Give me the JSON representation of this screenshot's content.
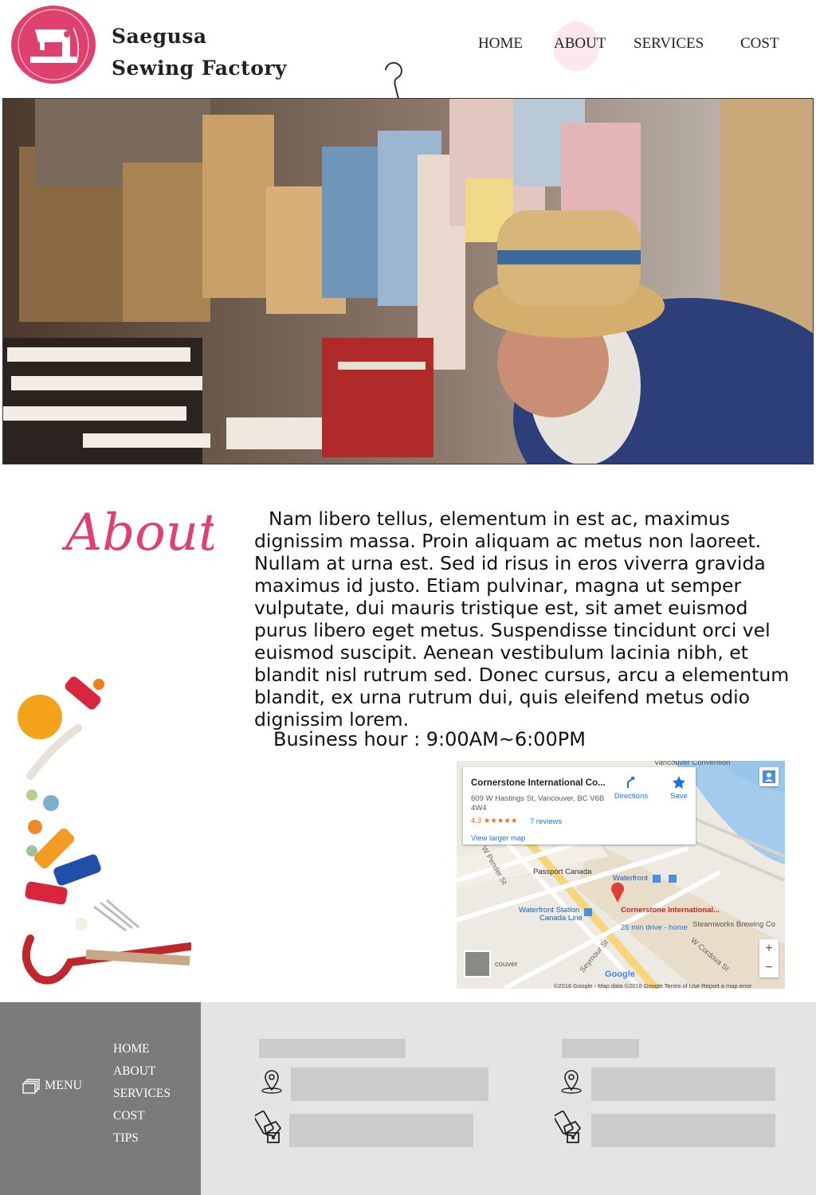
{
  "brand": {
    "line1": "Saegusa",
    "line2": "Sewing Factory",
    "accent_color": "#e0406e"
  },
  "nav": {
    "home": "HOME",
    "about": "ABOUT",
    "services": "SERVICES",
    "cost": "COST",
    "active": "ABOUT"
  },
  "about": {
    "heading": "About",
    "paragraph": "Nam libero tellus, elementum in est ac, maximus dignissim massa. Proin aliquam ac metus non laoreet. Nullam at urna est. Sed id risus in eros viverra gravida maximus id justo. Etiam pulvinar, magna ut semper vulputate, dui mauris tristique est, sit amet euismod purus libero eget metus. Suspendisse tincidunt orci vel euismod suscipit. Aenean vestibulum lacinia nibh, et blandit nisl rutrum sed. Donec cursus, arcu a elementum blandit, ex urna rutrum dui, quis eleifend metus odio dignissim lorem.",
    "hours_label": "Business hour : ",
    "hours_value": "9:00AM~6:00PM"
  },
  "map": {
    "place_name": "Cornerstone International Co...",
    "address": "609 W Hastings St, Vancouver, BC V6B 4W4",
    "rating": "4.3 ★★★★★",
    "reviews": "7 reviews",
    "view_larger": "View larger map",
    "directions": "Directions",
    "save": "Save",
    "labels": {
      "convention": "Vancouver Convention",
      "passport": "Passport Canada",
      "waterfront": "Waterfront",
      "waterfront_station": "Waterfront Station",
      "canada_line": "Canada Line",
      "pin_name": "Cornerstone International...",
      "drive": "25 min drive - home",
      "steamworks": "Steamworks Brewing Co",
      "w_pender": "W Pender St",
      "seymour": "Seymour St",
      "w_cordova": "W Cordova St",
      "couver": "couver",
      "google": "Google",
      "attribution": "©2016 Google - Map data ©2016 Google   Terms of Use   Report a map error"
    },
    "zoom_in": "+",
    "zoom_out": "−"
  },
  "footer": {
    "menu_label": "MENU",
    "links": [
      "HOME",
      "ABOUT",
      "SERVICES",
      "COST",
      "TIPS"
    ]
  },
  "icons": {
    "location": "location-pin-icon",
    "phone": "phone-icon",
    "menu": "menu-stack-icon"
  }
}
